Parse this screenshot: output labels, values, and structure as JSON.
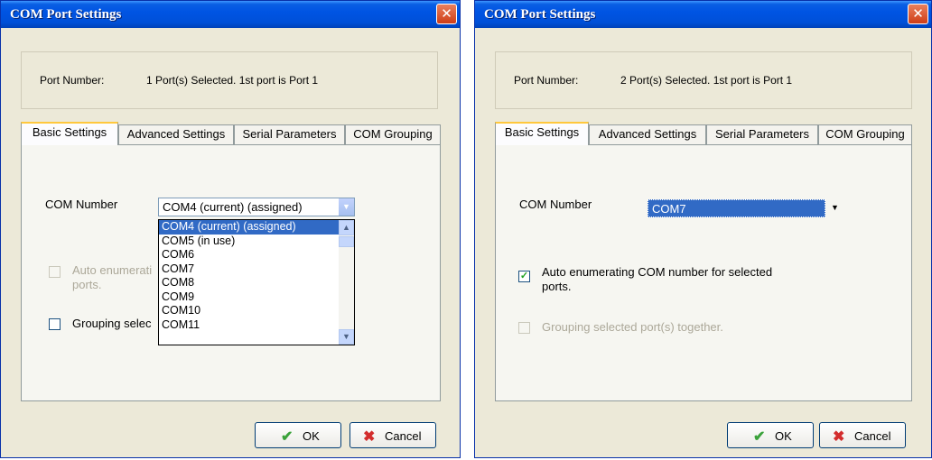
{
  "dialog1": {
    "title": "COM Port Settings",
    "close_glyph": "✕",
    "port_label": "Port Number:",
    "port_value": "1 Port(s) Selected. 1st port is Port 1",
    "tabs": [
      "Basic Settings",
      "Advanced Settings",
      "Serial Parameters",
      "COM Grouping"
    ],
    "active_tab": "Basic Settings",
    "com_label": "COM Number",
    "com_selected": "COM4 (current) (assigned)",
    "dropdown_items": [
      "COM4 (current) (assigned)",
      "COM5 (in use)",
      "COM6",
      "COM7",
      "COM8",
      "COM9",
      "COM10",
      "COM11"
    ],
    "auto_enum_label": "Auto enumerati",
    "auto_enum_label_line2": "ports.",
    "auto_enum_checked": false,
    "grouping_label": "Grouping selec",
    "grouping_checked": false,
    "ok_label": "OK",
    "cancel_label": "Cancel"
  },
  "dialog2": {
    "title": "COM Port Settings",
    "close_glyph": "✕",
    "port_label": "Port Number:",
    "port_value": "2 Port(s) Selected. 1st port is Port 1",
    "tabs": [
      "Basic Settings",
      "Advanced Settings",
      "Serial Parameters",
      "COM Grouping"
    ],
    "active_tab": "Basic Settings",
    "com_label": "COM Number",
    "com_selected": "COM7",
    "auto_enum_label": "Auto enumerating COM number for selected",
    "auto_enum_label_line2": "ports.",
    "auto_enum_checked": true,
    "grouping_label": "Grouping selected port(s) together.",
    "grouping_checked": false,
    "ok_label": "OK",
    "cancel_label": "Cancel"
  },
  "icons": {
    "ok": "checkmark-icon",
    "cancel": "x-icon",
    "combo_arrow": "chevron-down-icon"
  },
  "colors": {
    "title_bar": "#0054e3",
    "dialog_bg": "#ece9d8",
    "selection": "#316ac5",
    "close_button": "#cf3d16"
  }
}
